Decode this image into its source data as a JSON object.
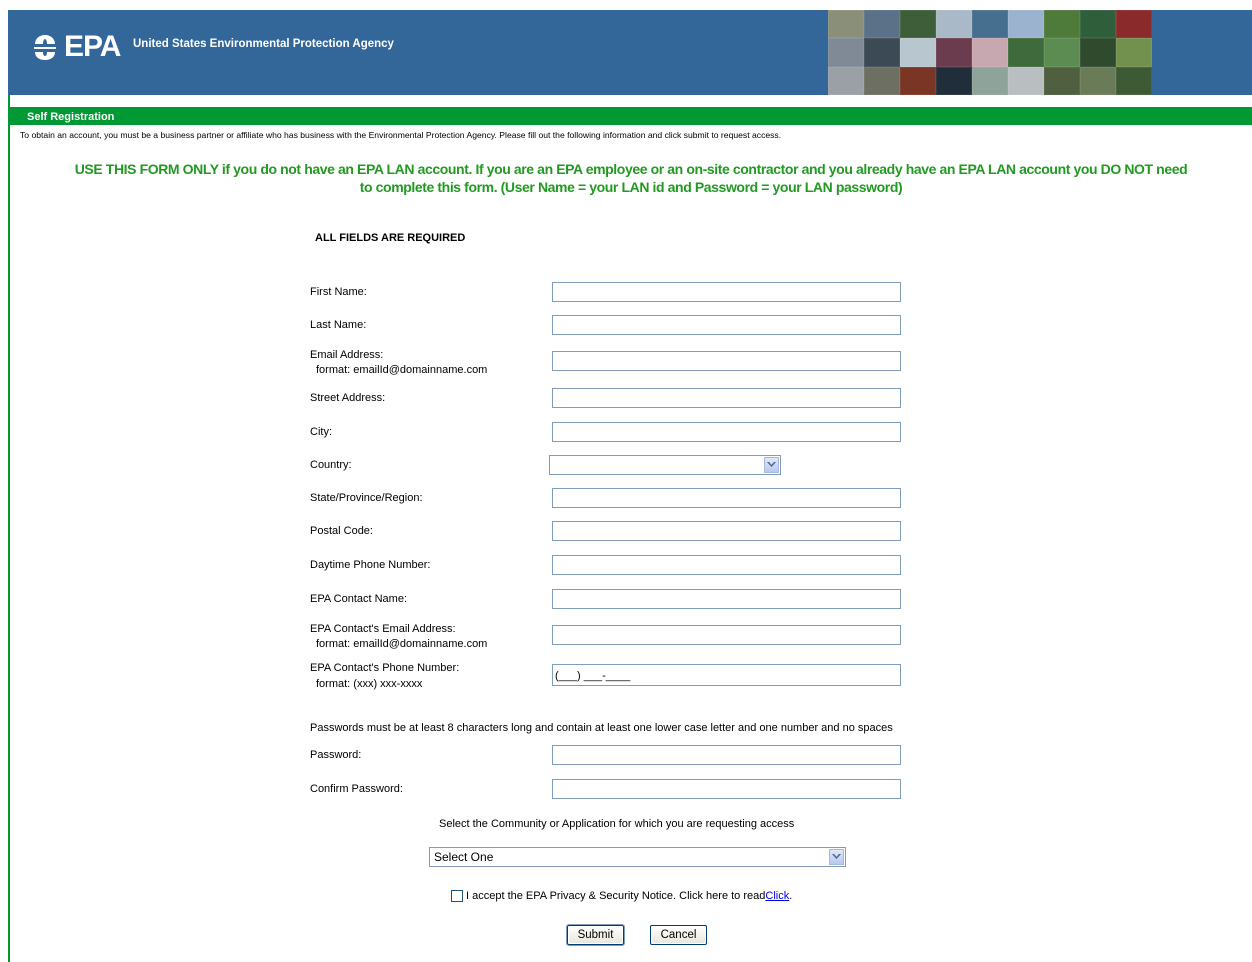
{
  "header": {
    "logo_text": "EPA",
    "agency_name": "United States Environmental Protection Agency",
    "brand_color": "#336699"
  },
  "section": {
    "title": "Self Registration",
    "intro": "To obtain an account, you must be a business partner or affiliate who has business with the Environmental Protection Agency. Please fill out the following information and click submit to request access.",
    "warning_line1": "USE THIS FORM ONLY if you do not have an EPA LAN account. If you are an EPA employee or an on-site contractor and you already have an EPA LAN account you DO NOT need",
    "warning_line2": "to complete this form. (User Name = your LAN id and Password = your LAN password)",
    "accent_color": "#009933"
  },
  "form": {
    "required_note": "ALL FIELDS ARE REQUIRED",
    "fields": {
      "first_name": {
        "label": "First Name:",
        "value": ""
      },
      "last_name": {
        "label": "Last Name:",
        "value": ""
      },
      "email": {
        "label": "Email Address:",
        "format": "format: emailId@domainname.com",
        "value": ""
      },
      "street": {
        "label": "Street Address:",
        "value": ""
      },
      "city": {
        "label": "City:",
        "value": ""
      },
      "country": {
        "label": "Country:",
        "selected": ""
      },
      "state": {
        "label": "State/Province/Region:",
        "value": ""
      },
      "postal": {
        "label": "Postal Code:",
        "value": ""
      },
      "phone": {
        "label": "Daytime Phone Number:",
        "value": ""
      },
      "contact_name": {
        "label": "EPA Contact Name:",
        "value": ""
      },
      "contact_email": {
        "label": "EPA Contact's Email Address:",
        "format": "format: emailId@domainname.com",
        "value": ""
      },
      "contact_phone": {
        "label": "EPA Contact's Phone Number:",
        "format": "format: (xxx) xxx-xxxx",
        "value": "(___) ___-____"
      },
      "password": {
        "label": "Password:",
        "value": ""
      },
      "confirm_password": {
        "label": "Confirm Password:",
        "value": ""
      }
    },
    "password_note": "Passwords must be at least 8 characters long and contain at least one lower case letter and one number and no spaces",
    "community_note": "Select the Community or Application for which you are requesting access",
    "community_select": "Select One",
    "accept_text": "I accept the EPA Privacy & Security Notice. Click here to read ",
    "accept_link": "Click",
    "submit_label": "Submit",
    "cancel_label": "Cancel"
  }
}
